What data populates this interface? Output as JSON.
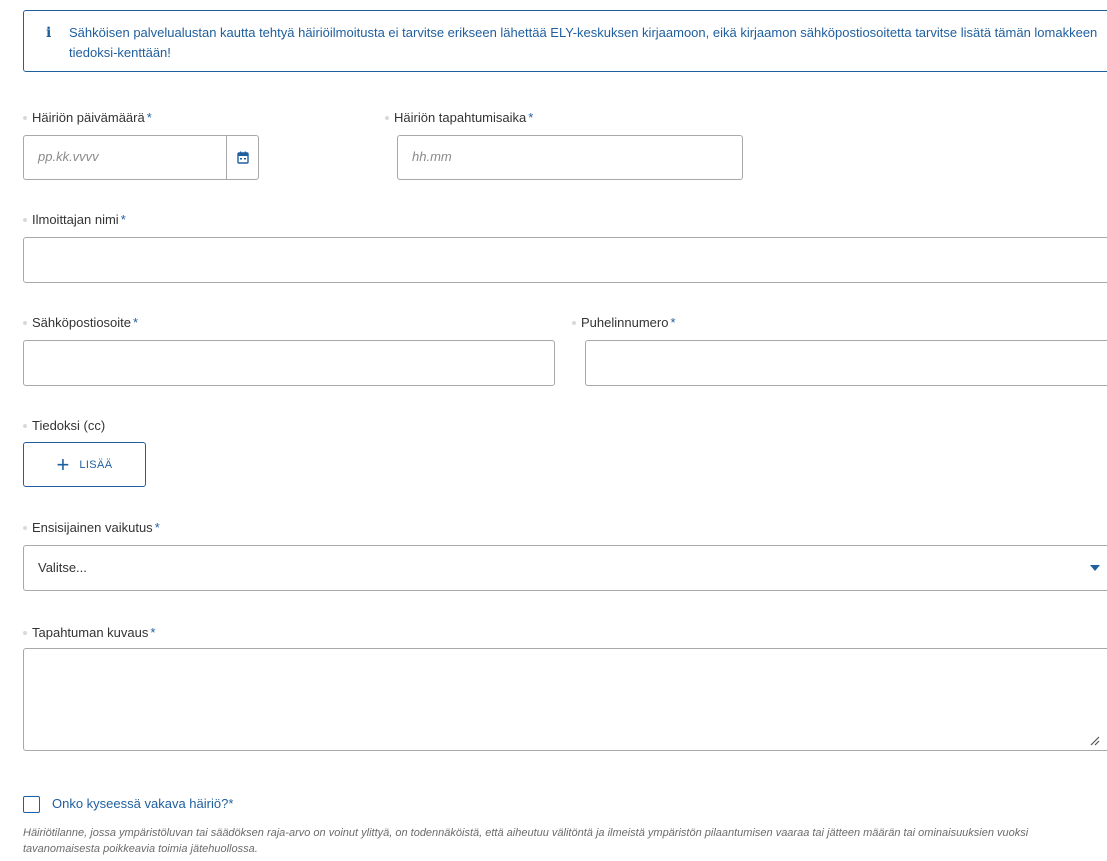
{
  "notice": {
    "icon": "info-icon",
    "icon_glyph": "i",
    "text": "Sähköisen palvelualustan kautta tehtyä häiriöilmoitusta ei tarvitse erikseen lähettää ELY-keskuksen kirjaamoon, eikä kirjaamon sähköpostiosoitetta tarvitse lisätä tämän lomakkeen tiedoksi-kenttään!"
  },
  "fields": {
    "date": {
      "label": "Häiriön päivämäärä",
      "placeholder": "pp.kk.vvvv",
      "value": "",
      "icon": "calendar-icon"
    },
    "time": {
      "label": "Häiriön tapahtumisaika",
      "placeholder": "hh.mm",
      "value": ""
    },
    "name": {
      "label": "Ilmoittajan nimi",
      "value": ""
    },
    "email": {
      "label": "Sähköpostiosoite",
      "value": ""
    },
    "phone": {
      "label": "Puhelinnumero",
      "value": ""
    },
    "cc": {
      "label": "Tiedoksi (cc)",
      "add_button": "LISÄÄ",
      "add_icon": "plus-icon"
    },
    "impact": {
      "label": "Ensisijainen vaikutus",
      "selected": "Valitse...",
      "icon": "chevron-down-icon"
    },
    "description": {
      "label": "Tapahtuman kuvaus",
      "value": "",
      "resize_icon": "resize-handle-icon"
    },
    "serious": {
      "label": "Onko kyseessä vakava häiriö?",
      "checked": false,
      "help": "Häiriötilanne, jossa ympäristöluvan tai säädöksen raja-arvo on voinut ylittyä, on todennäköistä, että aiheutuu välitöntä ja ilmeistä ympäristön pilaantumisen vaaraa tai jätteen määrän tai ominaisuuksien vuoksi tavanomaisesta poikkeavia toimia jätehuollossa."
    }
  },
  "required_marker": "*",
  "colors": {
    "accent": "#1f5f9e",
    "border": "#a8a8a8",
    "placeholder": "#8a8a8a",
    "help_text": "#6b6b6b"
  }
}
